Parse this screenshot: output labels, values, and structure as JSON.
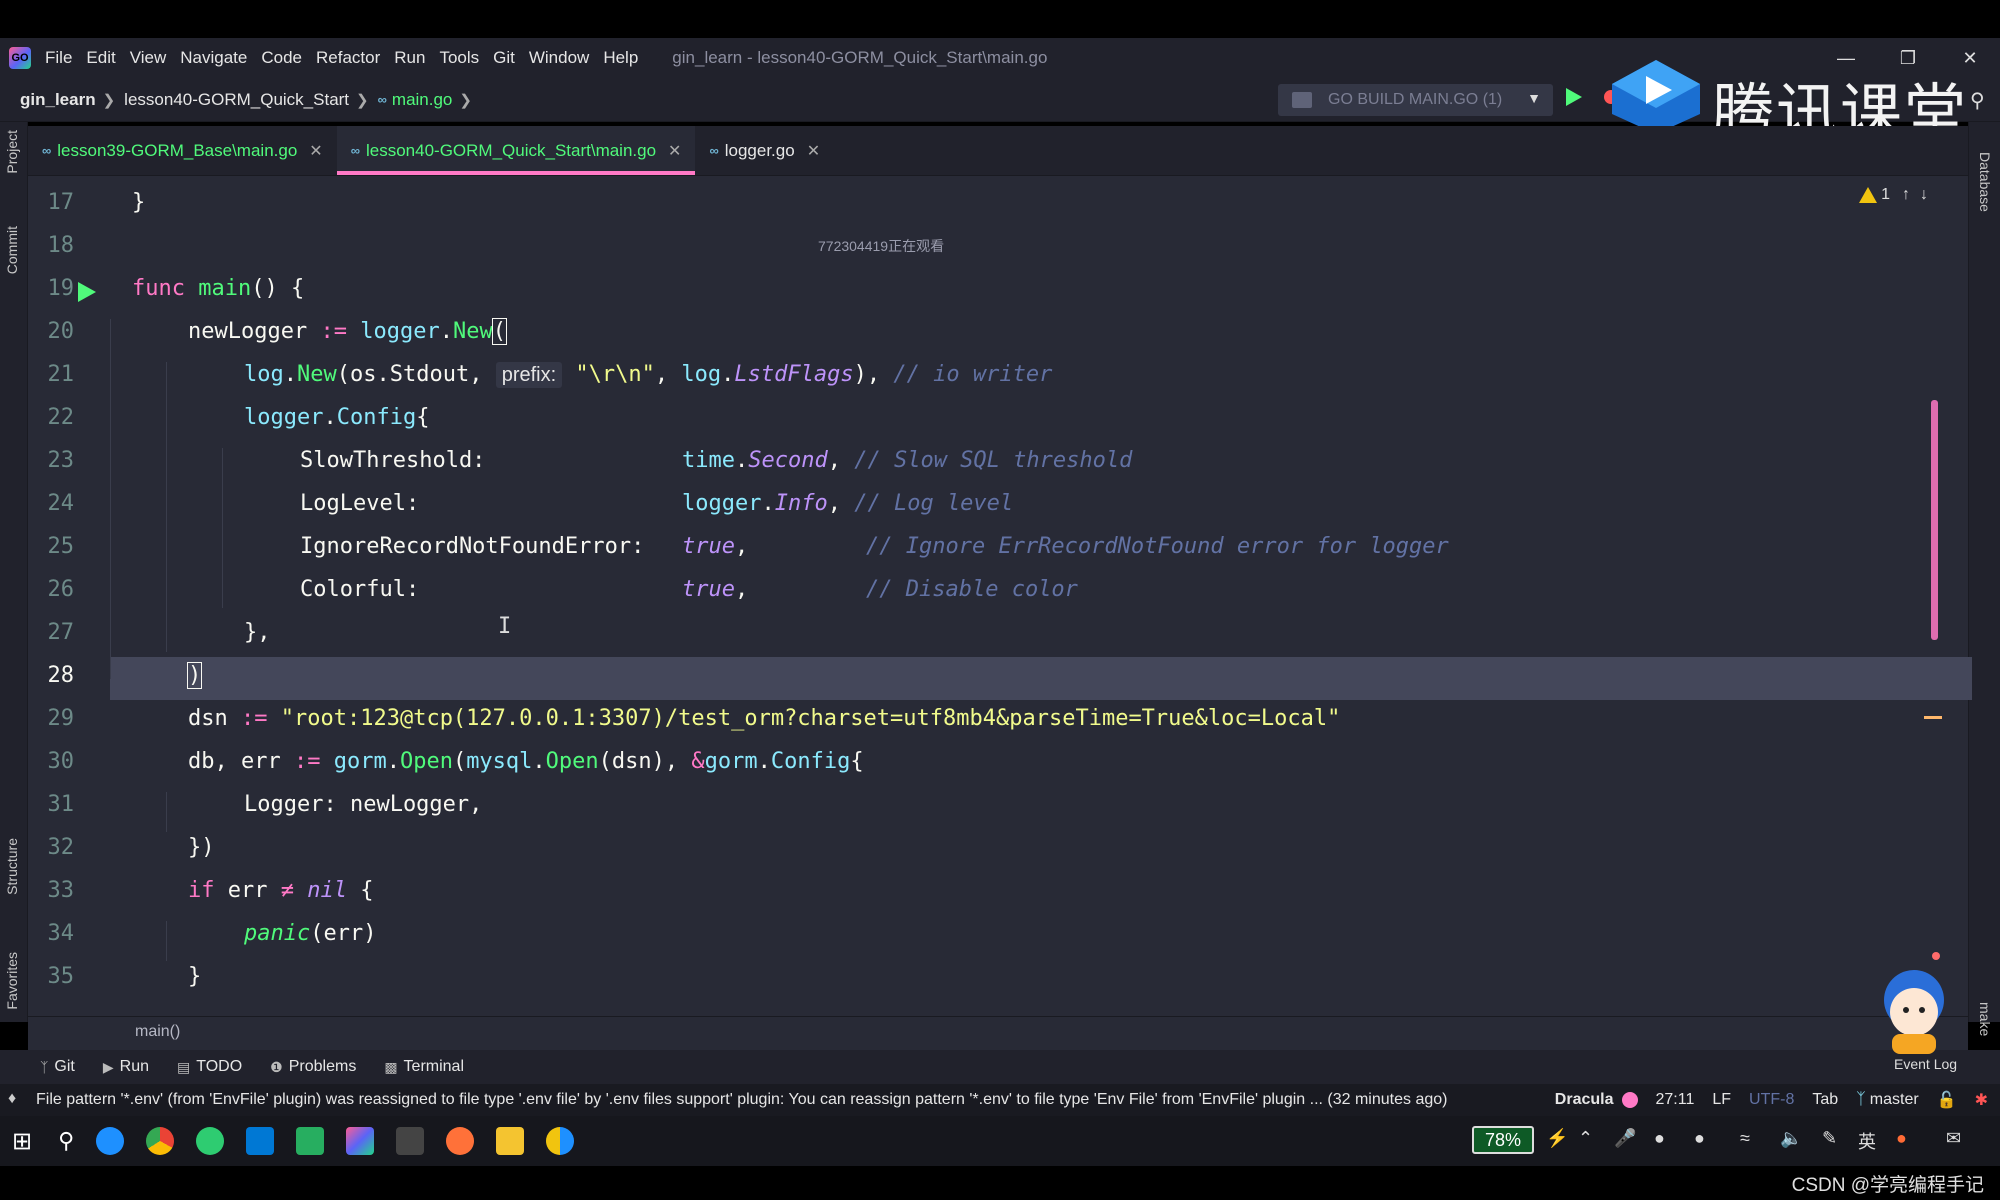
{
  "menu": {
    "items": [
      "File",
      "Edit",
      "View",
      "Navigate",
      "Code",
      "Refactor",
      "Run",
      "Tools",
      "Git",
      "Window",
      "Help"
    ],
    "window_title": "gin_learn - lesson40-GORM_Quick_Start\\main.go"
  },
  "nav": {
    "project": "gin_learn",
    "folder": "lesson40-GORM_Quick_Start",
    "file": "main.go",
    "run_config": "GO BUILD MAIN.GO (1)"
  },
  "watermark": {
    "brand": "腾讯课堂",
    "csdn": "CSDN @学亮编程手记"
  },
  "left_strip": {
    "project": "Project",
    "commit": "Commit",
    "structure": "Structure",
    "favorites": "Favorites"
  },
  "right_strip": {
    "database": "Database",
    "make": "make"
  },
  "tabs": [
    {
      "label": "lesson39-GORM_Base\\main.go",
      "active": false
    },
    {
      "label": "lesson40-GORM_Quick_Start\\main.go",
      "active": true
    },
    {
      "label": "logger.go",
      "active": false
    }
  ],
  "editor": {
    "watching": "772304419正在观看",
    "warning_count": "1",
    "line_numbers": [
      "17",
      "18",
      "19",
      "20",
      "21",
      "22",
      "23",
      "24",
      "25",
      "26",
      "27",
      "28",
      "29",
      "30",
      "31",
      "32",
      "33",
      "34",
      "35"
    ],
    "current_line": "28",
    "code": {
      "l17": "}",
      "l19_kw": "func",
      "l19_fn": "main",
      "l19_rest": "() {",
      "l20_a": "newLogger",
      "l20_op": ":=",
      "l20_pkg": "logger",
      "l20_dot": ".",
      "l20_fn": "New",
      "l20_paren": "(",
      "l21_pkg": "log",
      "l21_fn": "New",
      "l21_a": "(os.Stdout, ",
      "l21_hint": "prefix:",
      "l21_str": "\"\\r\\n\"",
      "l21_b": ", ",
      "l21_pkg2": "log",
      "l21_const": "LstdFlags",
      "l21_c": "), ",
      "l21_cm": "// io writer",
      "l22_pkg": "logger",
      "l22_ty": "Config",
      "l22_b": "{",
      "l23_key": "SlowThreshold:",
      "l23_pkg": "time",
      "l23_val": "Second",
      "l23_cm": "// Slow SQL threshold",
      "l24_key": "LogLevel:",
      "l24_pkg": "logger",
      "l24_val": "Info",
      "l24_cm": "// Log level",
      "l25_key": "IgnoreRecordNotFoundError:",
      "l25_val": "true",
      "l25_cm": "// Ignore ErrRecordNotFound error for logger",
      "l26_key": "Colorful:",
      "l26_val": "true",
      "l26_cm": "// Disable color",
      "l27": "},",
      "l28": ")",
      "l29_a": "dsn",
      "l29_op": ":=",
      "l29_str": "\"root:123@tcp(127.0.0.1:3307)/test_orm?charset=utf8mb4&parseTime=True&loc=Local\"",
      "l30_a": "db, err",
      "l30_op": ":=",
      "l30_pkg": "gorm",
      "l30_fn": "Open",
      "l30_pkg2": "mysql",
      "l30_fn2": "Open",
      "l30_b": "(dsn), ",
      "l30_amp": "&",
      "l30_pkg3": "gorm",
      "l30_ty": "Config",
      "l30_c": "{",
      "l31": "Logger: newLogger,",
      "l32": "})",
      "l33_kw": "if",
      "l33_a": "err",
      "l33_op": "≠",
      "l33_nil": "nil",
      "l33_b": "{",
      "l34_fn": "panic",
      "l34_b": "(err)",
      "l35": "}"
    },
    "breadcrumb": "main()"
  },
  "bottom_tools": [
    "Git",
    "Run",
    "TODO",
    "Problems",
    "Terminal"
  ],
  "status": {
    "message": "File pattern '*.env' (from 'EnvFile' plugin) was reassigned to file type '.env file' by '.env files support' plugin: You can reassign pattern '*.env' to file type 'Env File' from 'EnvFile' plugin ... (32 minutes ago)",
    "theme": "Dracula",
    "position": "27:11",
    "line_sep": "LF",
    "encoding": "UTF-8",
    "indent": "Tab",
    "branch": "master",
    "event_log": "Event Log"
  },
  "taskbar": {
    "battery": "78%",
    "ime": "英"
  },
  "colors": {
    "background": "#282a36",
    "current_line": "#44475a",
    "keyword": "#ff79c6",
    "function": "#50fa7b",
    "type": "#8be9fd",
    "string": "#f1fa8c",
    "comment": "#6272a4",
    "constant": "#bd93f9"
  }
}
